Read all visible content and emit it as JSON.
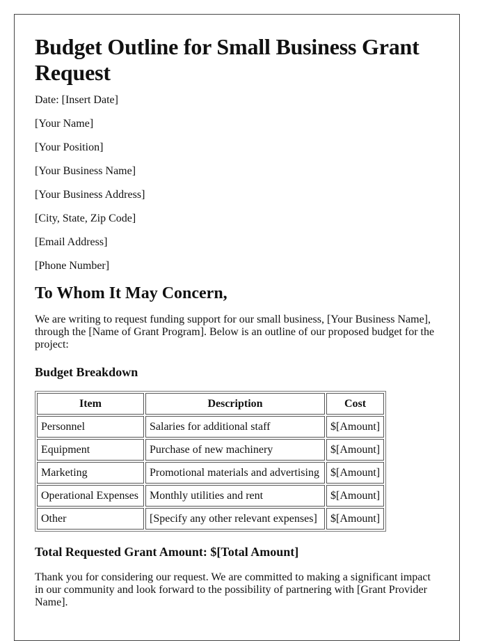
{
  "document": {
    "title": "Budget Outline for Small Business Grant Request",
    "info_lines": [
      "Date: [Insert Date]",
      "[Your Name]",
      "[Your Position]",
      "[Your Business Name]",
      "[Your Business Address]",
      "[City, State, Zip Code]",
      "[Email Address]",
      "[Phone Number]"
    ],
    "salutation": "To Whom It May Concern,",
    "intro": "We are writing to request funding support for our small business, [Your Business Name], through the [Name of Grant Program]. Below is an outline of our proposed budget for the project:",
    "budget_heading": "Budget Breakdown",
    "table": {
      "headers": [
        "Item",
        "Description",
        "Cost"
      ],
      "rows": [
        [
          "Personnel",
          "Salaries for additional staff",
          "$[Amount]"
        ],
        [
          "Equipment",
          "Purchase of new machinery",
          "$[Amount]"
        ],
        [
          "Marketing",
          "Promotional materials and advertising",
          "$[Amount]"
        ],
        [
          "Operational Expenses",
          "Monthly utilities and rent",
          "$[Amount]"
        ],
        [
          "Other",
          "[Specify any other relevant expenses]",
          "$[Amount]"
        ]
      ]
    },
    "total": "Total Requested Grant Amount: $[Total Amount]",
    "closing": "Thank you for considering our request. We are committed to making a significant impact in our community and look forward to the possibility of partnering with [Grant Provider Name]."
  }
}
